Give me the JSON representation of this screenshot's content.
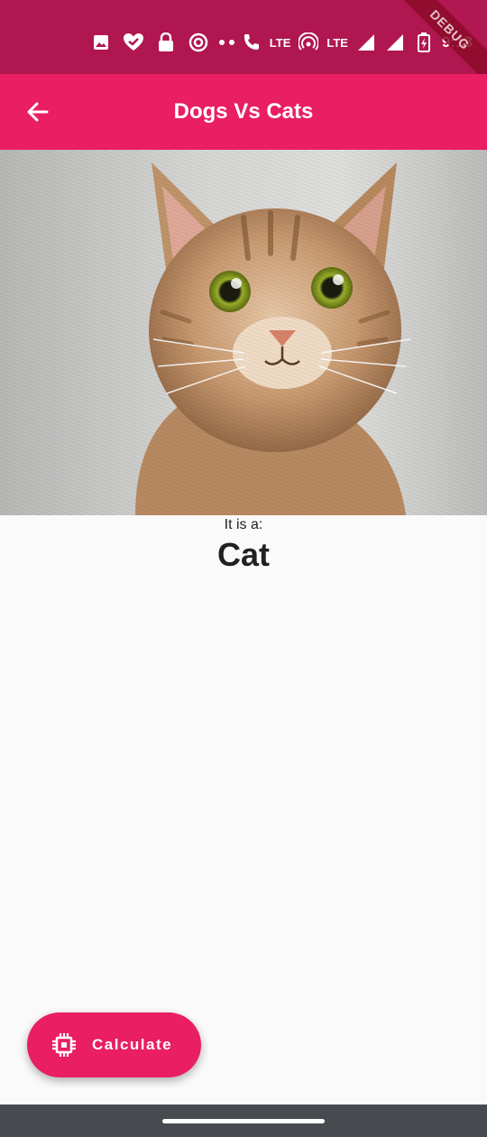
{
  "status_bar": {
    "time": "9:18",
    "lte_1": "LTE",
    "lte_2": "LTE",
    "debug_banner": "DEBUG",
    "icons": [
      "image-icon",
      "heart-check-icon",
      "lock-icon",
      "at-icon",
      "dot",
      "dot",
      "wifi-call-icon",
      "hotspot-icon",
      "signal-icon",
      "signal-icon",
      "battery-charging-icon"
    ]
  },
  "app_bar": {
    "title": "Dogs Vs Cats",
    "back_icon": "arrow-back-icon"
  },
  "image": {
    "subject": "cat-photo"
  },
  "result": {
    "label": "It is a:",
    "value": "Cat"
  },
  "fab": {
    "label": "Calculate",
    "icon": "cpu-chip-icon"
  },
  "colors": {
    "status_bar": "#b0164f",
    "primary": "#e91e63",
    "background": "#fafafa",
    "nav_bar": "#474b50"
  }
}
